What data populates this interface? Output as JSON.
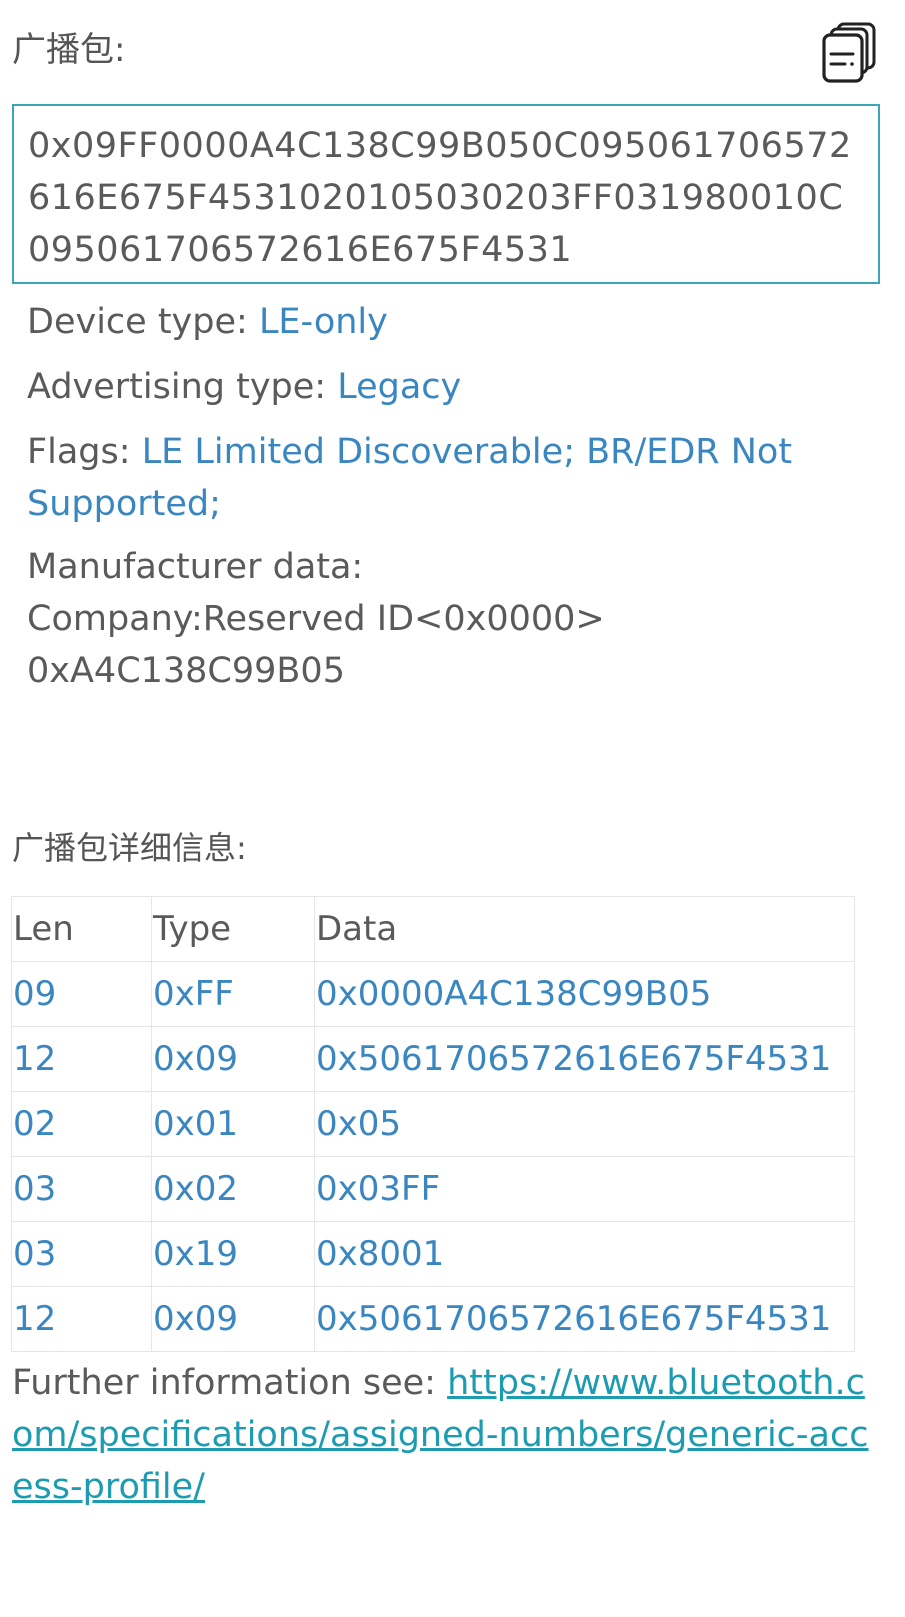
{
  "header": {
    "title": "广播包:",
    "copy_icon": "copy-icon"
  },
  "raw_packet": "0x09FF0000A4C138C99B050C095061706572616E675F4531020105030203FF031980010C095061706572616E675F4531",
  "info": {
    "device_type_label": "Device type: ",
    "device_type_value": "LE-only",
    "advertising_type_label": "Advertising type: ",
    "advertising_type_value": "Legacy",
    "flags_label": "Flags: ",
    "flags_value": "LE Limited Discoverable; BR/EDR Not Supported;",
    "manufacturer_line1": "Manufacturer data:",
    "manufacturer_line2": "Company:Reserved ID<0x0000>",
    "manufacturer_line3": "0xA4C138C99B05"
  },
  "details": {
    "title": "广播包详细信息:",
    "headers": [
      "Len",
      "Type",
      "Data"
    ],
    "rows": [
      [
        "09",
        "0xFF",
        "0x0000A4C138C99B05"
      ],
      [
        "12",
        "0x09",
        "0x5061706572616E675F4531"
      ],
      [
        "02",
        "0x01",
        "0x05"
      ],
      [
        "03",
        "0x02",
        "0x03FF"
      ],
      [
        "03",
        "0x19",
        "0x8001"
      ],
      [
        "12",
        "0x09",
        "0x5061706572616E675F4531"
      ]
    ]
  },
  "further": {
    "label": "Further information see: ",
    "link": "https://www.bluetooth.com/specifications/assigned-numbers/generic-access-profile/"
  },
  "colors": {
    "accent": "#3a86c0",
    "border": "#3aa7b8",
    "link": "#1d9bb0",
    "text": "#5a5a5a"
  }
}
